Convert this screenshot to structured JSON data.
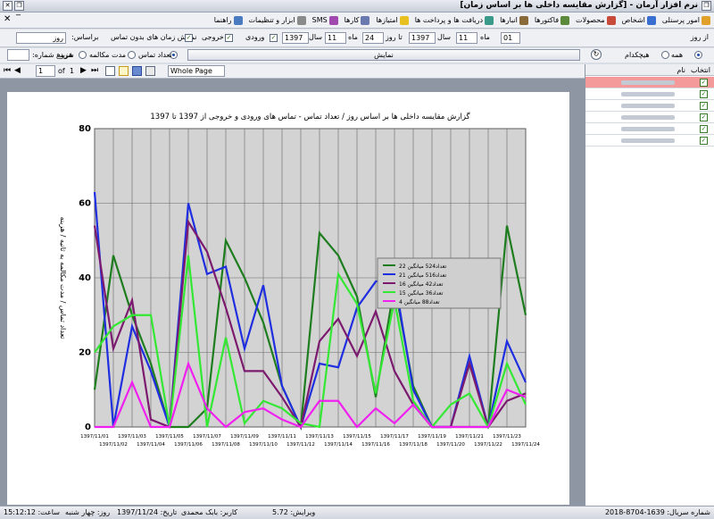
{
  "window": {
    "title": "نرم افزار آرمان - [گزارش مقایسه داخلی ها بر اساس زمان]"
  },
  "menu": {
    "items": [
      "امور پرسنلی",
      "اشخاص",
      "محصولات",
      "فاکتورها",
      "انبارها",
      "دریافت ها و پرداخت ها",
      "امتیازها",
      "کارها",
      "SMS",
      "ابزار و تنظیمات",
      "راهنما"
    ]
  },
  "filters": {
    "from_day_label": "از روز",
    "from_day": "01",
    "month_label": "ماه",
    "from_month": "11",
    "year_label": "سال",
    "from_year": "1397",
    "to_day_label": "تا روز",
    "to_day": "24",
    "to_month": "11",
    "to_year": "1397",
    "incoming_label": "ورودی",
    "outgoing_label": "خروجی",
    "no_contact_label": "نمایش زمان های بدون تماس",
    "basis_label": "براساس:",
    "basis_value": "روز"
  },
  "options": {
    "all_label": "همه",
    "none_label": "هیچکدام",
    "show_button": "نمایش",
    "count_label": "تعداد تماس",
    "duration_label": "مدت مکالمه",
    "average_label": "هزینه",
    "start_number_label": "شروع شماره:"
  },
  "toolbar": {
    "page_value": "1",
    "of_label": "of",
    "total_pages": "1",
    "zoom": "Whole Page"
  },
  "grid": {
    "col_select": "انتخاب",
    "col_name": "نام",
    "rows": 6
  },
  "status": {
    "serial": "شماره سریال: 1639-8704-2018",
    "version": "ویرایش: 5.72",
    "user": "کاربر: بابک محمدی",
    "date": "تاریخ: 1397/11/24",
    "day": "روز: چهار شنبه",
    "time": "ساعت: 15:12:12"
  },
  "chart_data": {
    "type": "line",
    "title": "گزارش مقایسه داخلی ها بر اساس روز / تعداد تماس - تماس های ورودی و خروجی از 1397 تا 1397",
    "ylabel": "تعداد تماس / مدت مکالمه به ثانیه / هزینه",
    "xlabel": "",
    "ylim": [
      0,
      80
    ],
    "yticks": [
      0,
      20,
      40,
      60,
      80
    ],
    "grid": true,
    "legend_position": "right",
    "categories": [
      "1397/11/01",
      "1397/11/02",
      "1397/11/03",
      "1397/11/04",
      "1397/11/05",
      "1397/11/06",
      "1397/11/07",
      "1397/11/08",
      "1397/11/09",
      "1397/11/10",
      "1397/11/11",
      "1397/11/12",
      "1397/11/13",
      "1397/11/14",
      "1397/11/15",
      "1397/11/16",
      "1397/11/17",
      "1397/11/18",
      "1397/11/19",
      "1397/11/20",
      "1397/11/21",
      "1397/11/22",
      "1397/11/23",
      "1397/11/24"
    ],
    "series": [
      {
        "name": "تعداد524 میانگین 22",
        "color": "#1e7d1e",
        "values": [
          10,
          46,
          30,
          17,
          0,
          0,
          5,
          50,
          40,
          28,
          11,
          0,
          52,
          46,
          35,
          8,
          38,
          11,
          0,
          0,
          0,
          0,
          54,
          30
        ]
      },
      {
        "name": "تعداد516 میانگین 21",
        "color": "#1f2fe0",
        "values": [
          63,
          0,
          27,
          15,
          0,
          60,
          41,
          43,
          21,
          38,
          11,
          0,
          17,
          16,
          32,
          39,
          40,
          10,
          0,
          0,
          19,
          0,
          23,
          12
        ]
      },
      {
        "name": "تعداد42 میانگین 16",
        "color": "#7b1a6e",
        "values": [
          54,
          21,
          34,
          2,
          0,
          55,
          47,
          32,
          15,
          15,
          8,
          0,
          23,
          29,
          19,
          31,
          15,
          6,
          0,
          0,
          17,
          0,
          7,
          9
        ]
      },
      {
        "name": "تعداد36 میانگین 15",
        "color": "#33e833",
        "values": [
          20,
          27,
          30,
          30,
          0,
          46,
          0,
          24,
          1,
          7,
          5,
          1,
          0,
          41,
          33,
          9,
          34,
          7,
          0,
          6,
          9,
          0,
          17,
          6
        ]
      },
      {
        "name": "تعداد88 میانگین 4",
        "color": "#f020f0",
        "values": [
          0,
          0,
          12,
          0,
          0,
          17,
          5,
          0,
          4,
          5,
          2,
          0,
          7,
          7,
          0,
          5,
          1,
          6,
          0,
          0,
          0,
          0,
          10,
          8
        ]
      }
    ]
  }
}
